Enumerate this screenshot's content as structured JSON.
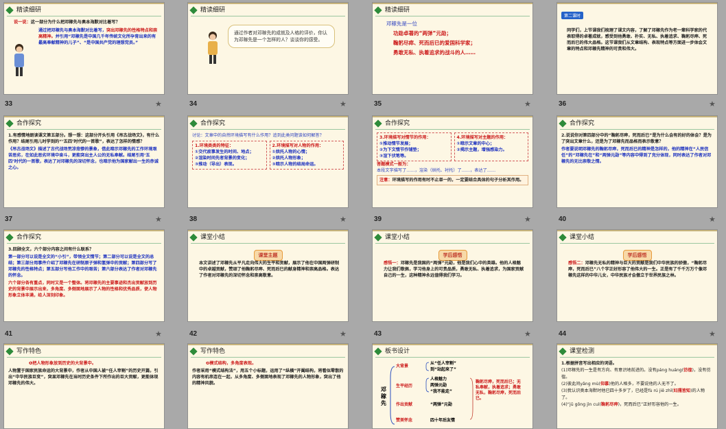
{
  "header_labels": {
    "jingdu": "精读细研",
    "hezuo": "合作探究",
    "xiaojie": "课堂小结",
    "xiezuo": "写作特色",
    "banshu": "板书设计",
    "jiance": "课堂检测"
  },
  "second_lesson_badge": "第二课时",
  "slide_numbers": [
    "33",
    "34",
    "35",
    "36",
    "37",
    "38",
    "39",
    "40",
    "41",
    "42",
    "43",
    "44"
  ],
  "s33": {
    "q_lead": "说一说：",
    "q": "这一部分为什么把邓稼先与奥本海默对比着写？",
    "a1": "通过把邓稼先与奥本海默对比着写，",
    "a2": "突出邓稼先的性格特点和崇高精神。",
    "a3": "并引用“邓稼先是中国几千年传统文化所孕育出来的有最高奉献精神的儿子”、“是中国共产党的理想党员。”"
  },
  "s34": {
    "bubble": "通过作者对邓稼先的成就及人格的评价，你认为邓稼先是一个怎样的人？谈谈你的感受。"
  },
  "s35": {
    "lead": "邓稼先是一位",
    "l1": "功勋卓著的“两弹”元勋；",
    "l2": "鞠躬尽瘁、死而后已的爱国科学家；",
    "l3": "勇敢无私、执着追求的战斗的人……"
  },
  "s36": {
    "text": "同学们，上节课我们梳理了课文内容，了解了邓稼先作为老一辈科学家的代表取得的卓著成就，感受到他勇敢、朴实、无私、执着追求、鞠躬尽瘁、死而后已的伟大品格。这节课我们从文章结构、表现特点等方面进一步体会文章的特点和邓稼先精神的可贵和伟大。"
  },
  "s37": {
    "q": "1.有感情地朗读课文第五部分。想一想：这部分开头引用《吊古战场文》，有什么作用？结尾引用儿时学到的“‘五四’时代的一首歌”，表达了怎样的情感？",
    "a": "《吊古战场文》描述了古代战场荒凉悲惨的景象，借此暗示邓稼先的工作环境艰苦恶劣，在如此恶劣环境中奋斗，更能突出主人公的无私奉献。结尾引用‘五四’时代的一首歌，表达了对邓稼先的深切怀念，也暗示他为国家献出一生的赤诚之心。"
  },
  "s38": {
    "q": "讨论：文章中的自然环境描写有什么作用？追到此类问题该如何解答？",
    "c1_title": "1.环境类类的特征：",
    "c1_items": [
      "①交代故事发生的时间、地点；",
      "②渲染时间先者背景的变化；",
      "③推动（导出）表现。"
    ],
    "c2_title": "2.环境描写对人物的作用：",
    "c2_items": [
      "①烘托人物的心情；",
      "②烘托人物形象；",
      "③暗示人物的结局命运。"
    ]
  },
  "s39": {
    "t1": "3.环境描写对情节的作用：",
    "t1_items": [
      "①推动情节发展；",
      "②为下文情节作铺垫；",
      "③渲下伏笔等。"
    ],
    "t2": "4.环境描写对主题的作用：",
    "t2_items": [
      "①暗示文章的中心；",
      "②揭示主题，增强感染力。"
    ],
    "ans_title": "答题模式一般为：",
    "ans": "本段文字描写了……，渲染（烘托、衬托）了……，表达了……",
    "note_lead": "注意：",
    "note": "环境描写的作用有时不止单一的，一定要结合具体的句子分析其作用。"
  },
  "s40": {
    "q": "2.说说你对第四部分中的“鞠躬尽瘁，死而后已”是为什么会有的好的体会？是为了突出文章什么，还是为了邓稼先而品格而表示敬意？",
    "a": "作者要说明邓稼先的鞠躬尽瘁，死而后已的精神是怎样的，他的精神在“人民信任”的“邓稼先在”和“两弹元勋”等内容中得到了充分体现，同时表达了作者对邓稼先的无比崇敬之情。"
  },
  "s41": {
    "q": "3.回顾全文，六个部分内容之间有什么联系？",
    "a": "第一部分可以说是全文的“小引”，带领全文情节；第二部分可以说是全文的总结；第三部分用事件介绍了邓稼先在研制原子弹和氢弹中的贡献；第四部分写了邓稼先的性格特点；第五部分写他工作中的艰苦；第六部分表达了作者对邓稼先的怀念。",
    "b": "六个部分各有重点，同时又是一个整体。将邓稼先的主要事迹和杰出贡献放到历史的背景中展示出来，多角度、多侧面地展示了人物的性格和优秀品质，使人物形象立体丰满，给人深刻印象。"
  },
  "s42": {
    "tag": "课堂主题",
    "text": "本文讲述了邓稼先从平凡走向伟大的生平和贡献，展示了他在中国两弹研制中的卓越贡献，赞颂了他鞠躬尽瘁、死而后已的献身精神和崇高品格。表达了作者对邓稼先的深切怀念和崇高敬意。"
  },
  "s43": {
    "tag": "学后感悟",
    "lead": "感悟一：",
    "text": "邓稼先是我国的“两弹”元勋，他是我们心中的英雄。他的人格魅力让我们敬佩，学习他身上的可贵品质，勇敢无私、执着追求，为国家贡献自己的一生，这种精神永远值得我们学习。"
  },
  "s44": {
    "tag": "学后感悟",
    "lead": "感悟二：",
    "text": "邓稼先无私的精神与巨大的贡献是我们中华民族的骄傲，“鞠躬尽瘁，死而后已”八个字正好形容了他伟大的一生。正是有了千千万万个像邓稼先这样的中华儿女，中华民族才会傲立于世界民族之林。"
  },
  "s45": {
    "title": "❶把人物形象放到历史的大背景中。",
    "text": "人物置于国家民族命运的大背景中，作者从中国人被“任人宰割”的历史开篇，引出“中华民族巨变”，突显邓稼先在当时历史条件下所作出的巨大贡献，更能体现邓稼先的伟大。"
  },
  "s46": {
    "title": "❷模式结构，多角度表现。",
    "text": "作者采用“模式结构法”，用五个小标题，运用了“纵横”开阖结构，将看似零散的内容有机串连在一起，从多角度、多侧面地表现了邓稼先的人物形象，突出了他的精神风貌。"
  },
  "s47": {
    "root": "邓稼先",
    "b1": "大背景",
    "b1a": "从“任人宰割”",
    "b1b": "到“站起来了”",
    "b2": "生平经历",
    "b2a": "人格魅力",
    "b2b": "两弹元勋",
    "b2c": "“我不能走”",
    "b3": "作出贡献",
    "b3a": "“两弹”元勋",
    "b4": "赞美怀念",
    "b4a": "四十年后友情",
    "right": "鞠躬尽瘁，死而后已；无私奉献，执着追求；勇敢无私，鞠躬尽瘁，死而后已。"
  },
  "s48": {
    "q": "1.根据拼音写出相应的词语。",
    "i1": "(1)邓稼先的一生是有方向、有意识地前进的。没有páng huáng(",
    "a1": "彷徨",
    "i1e": ")，没有彷徨。",
    "i2": "(2)彼此间yǎng mù(",
    "a2": "仰慕",
    "i2e": ")他的人格多，不要说他的人无不了。",
    "i3": "(3)我认识奥本海默时他已四十多岁了，已经是fù rú jiē zhī(",
    "a3": "妇孺皆知",
    "i3e": ")的人物了。",
    "i4": "(4)“jū gōng jìn cuì(",
    "a4": "鞠躬尽瘁",
    "i4e": ")，死而后已”正好形容他的一生。"
  }
}
